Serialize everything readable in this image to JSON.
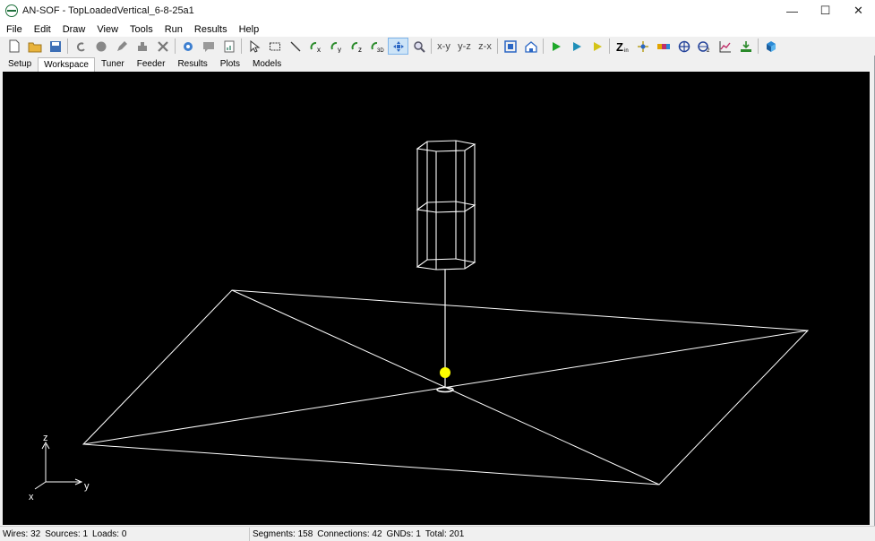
{
  "window": {
    "title": "AN-SOF - TopLoadedVertical_6-8-25a1",
    "minimize": "—",
    "maximize": "☐",
    "close": "✕"
  },
  "menu": [
    "File",
    "Edit",
    "Draw",
    "View",
    "Tools",
    "Run",
    "Results",
    "Help"
  ],
  "toolbar": {
    "view_xy": "x-y",
    "view_yz": "y-z",
    "view_zx": "z-x"
  },
  "tabs": [
    {
      "label": "Setup"
    },
    {
      "label": "Workspace",
      "active": true
    },
    {
      "label": "Tuner"
    },
    {
      "label": "Feeder"
    },
    {
      "label": "Results"
    },
    {
      "label": "Plots"
    },
    {
      "label": "Models"
    }
  ],
  "axes": {
    "x": "x",
    "y": "y",
    "z": "z"
  },
  "colors": {
    "viewport_bg": "#000000",
    "wire": "#ffffff",
    "source": "#ffff00"
  },
  "status": {
    "wires": "Wires: 32",
    "sources": "Sources: 1",
    "loads": "Loads: 0",
    "segments": "Segments: 158",
    "connections": "Connections: 42",
    "gnds": "GNDs: 1",
    "total": "Total: 201"
  }
}
